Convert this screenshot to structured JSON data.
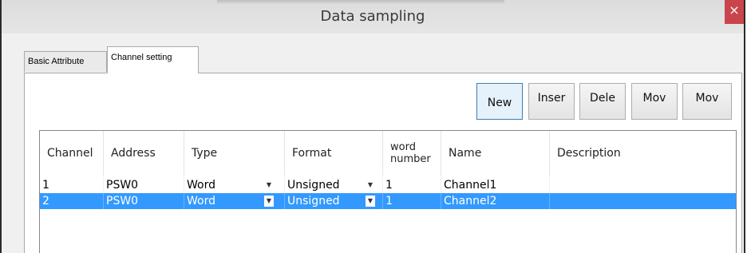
{
  "window": {
    "title": "Data sampling",
    "close_label": "×"
  },
  "tabs": [
    {
      "label": "Basic Attribute"
    },
    {
      "label": "Channel setting"
    }
  ],
  "toolbar": {
    "new_label": "New",
    "insert_label": "Inser",
    "delete_label": "Dele",
    "move_up_label": "Mov",
    "move_down_label": "Mov"
  },
  "table": {
    "columns": [
      "Channel",
      "Address",
      "Type",
      "Format",
      "word\nnumber",
      "Name",
      "Description"
    ],
    "rows": [
      {
        "channel": "1",
        "address": "PSW0",
        "type": "Word",
        "format": "Unsigned",
        "word_number": "1",
        "name": "Channel1",
        "description": ""
      },
      {
        "channel": "2",
        "address": "PSW0",
        "type": "Word",
        "format": "Unsigned",
        "word_number": "1",
        "name": "Channel2",
        "description": ""
      }
    ],
    "selected_row": 2
  },
  "icons": {
    "dropdown": "dropdown-arrow-icon"
  },
  "colors": {
    "selection": "#3399ff",
    "close": "#c8464b"
  }
}
